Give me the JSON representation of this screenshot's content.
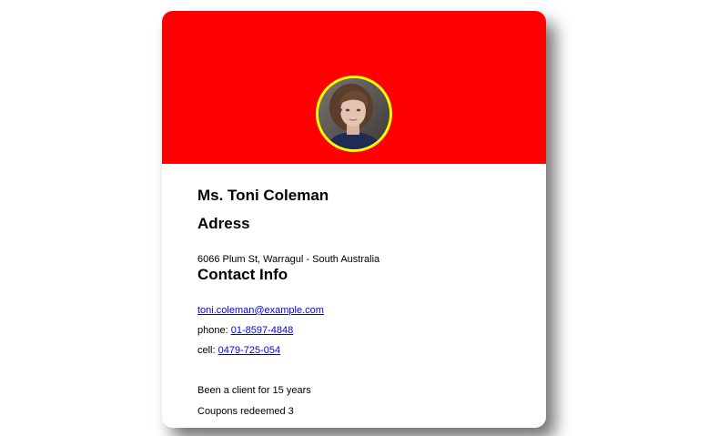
{
  "profile": {
    "name": "Ms. Toni Coleman",
    "colors": {
      "header_background": "#ff0000",
      "avatar_border": "#ffff00",
      "link": "#0000ee"
    }
  },
  "address": {
    "title": "Adress",
    "text": "6066 Plum St, Warragul - South Australia"
  },
  "contact": {
    "title": "Contact Info",
    "email": "toni.coleman@example.com",
    "phone_label": "phone: ",
    "phone": "01-8597-4848",
    "cell_label": "cell: ",
    "cell": "0479-725-054"
  },
  "stats": {
    "client_since": "Been a client for 15 years",
    "coupons": "Coupons redeemed 3"
  }
}
